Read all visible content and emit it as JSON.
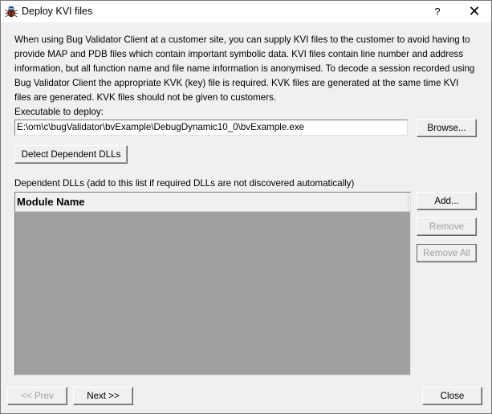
{
  "window": {
    "title": "Deploy KVI files",
    "help_label": "?",
    "close_glyph": "✕",
    "icon": "bug-icon"
  },
  "description": "When using Bug Validator Client at a customer site, you can supply KVI files to the customer to avoid having to provide MAP and PDB files which contain important symbolic data. KVI files contain line number and address information, but all function name and file name information is anonymised. To decode a session recorded using Bug Validator Client the appropriate KVK (key) file is required. KVK files are generated at the same time KVI files are generated. KVK files should not be given to customers.",
  "executable": {
    "label": "Executable to deploy:",
    "value": "E:\\om\\c\\bugValidator\\bvExample\\DebugDynamic10_0\\bvExample.exe",
    "browse_label": "Browse..."
  },
  "detect_label": "Detect Dependent DLLs",
  "dlls": {
    "label": "Dependent DLLs (add to this list if required DLLs are not discovered automatically)",
    "columns": [
      "Module Name"
    ],
    "rows": [],
    "add_label": "Add...",
    "remove_label": "Remove",
    "remove_all_label": "Remove All"
  },
  "footer": {
    "prev_label": "<< Prev",
    "next_label": "Next >>",
    "close_label": "Close"
  }
}
